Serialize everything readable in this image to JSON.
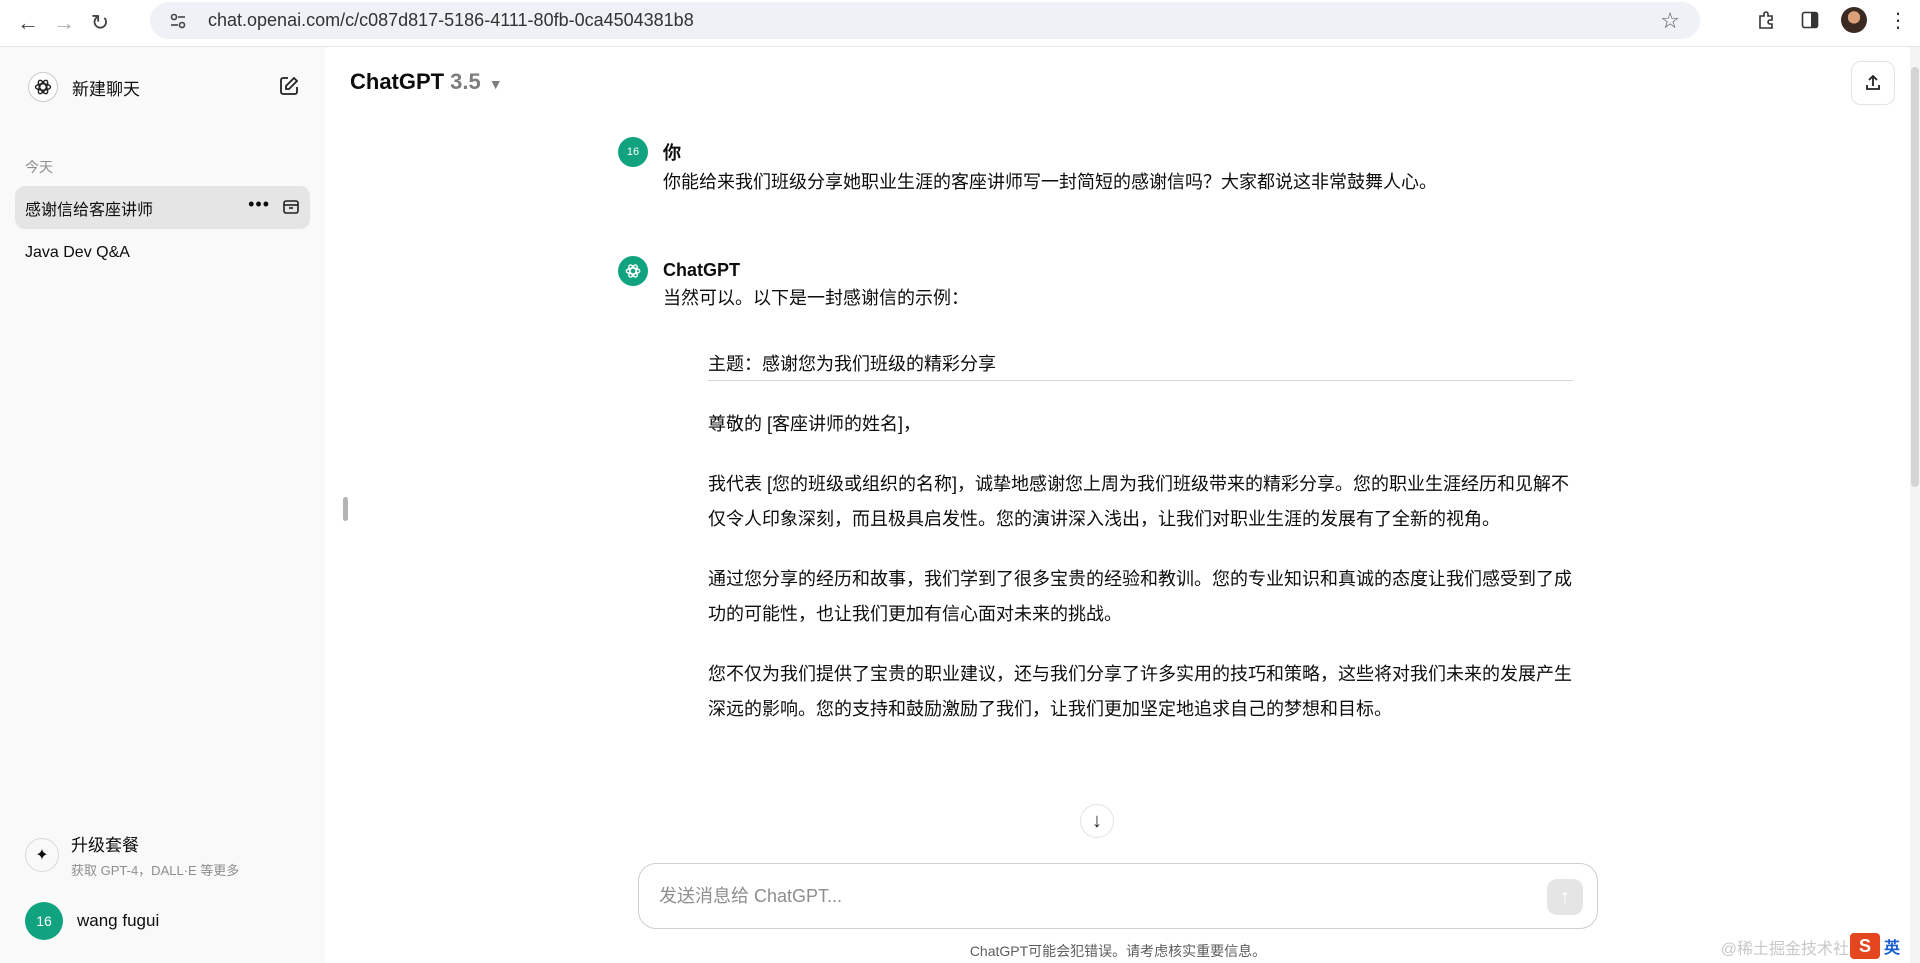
{
  "browser": {
    "url": "chat.openai.com/c/c087d817-5186-4111-80fb-0ca4504381b8"
  },
  "sidebar": {
    "new_chat_label": "新建聊天",
    "section_today": "今天",
    "conversations": [
      {
        "title": "感谢信给客座讲师",
        "active": true
      },
      {
        "title": "Java Dev Q&A",
        "active": false
      }
    ],
    "upgrade_title": "升级套餐",
    "upgrade_subtitle": "获取 GPT-4，DALL·E 等更多",
    "user_avatar_text": "16",
    "user_name": "wang fugui"
  },
  "header": {
    "model_name": "ChatGPT",
    "model_version": "3.5"
  },
  "messages": {
    "user": {
      "avatar_text": "16",
      "author": "你",
      "text": "你能给来我们班级分享她职业生涯的客座讲师写一封简短的感谢信吗？大家都说这非常鼓舞人心。"
    },
    "assistant": {
      "author": "ChatGPT",
      "intro": "当然可以。以下是一封感谢信的示例：",
      "letter": [
        "主题：感谢您为我们班级的精彩分享",
        "尊敬的 [客座讲师的姓名]，",
        "我代表 [您的班级或组织的名称]，诚挚地感谢您上周为我们班级带来的精彩分享。您的职业生涯经历和见解不仅令人印象深刻，而且极具启发性。您的演讲深入浅出，让我们对职业生涯的发展有了全新的视角。",
        "通过您分享的经历和故事，我们学到了很多宝贵的经验和教训。您的专业知识和真诚的态度让我们感受到了成功的可能性，也让我们更加有信心面对未来的挑战。",
        "您不仅为我们提供了宝贵的职业建议，还与我们分享了许多实用的技巧和策略，这些将对我们未来的发展产生深远的影响。您的支持和鼓励激励了我们，让我们更加坚定地追求自己的梦想和目标。"
      ]
    }
  },
  "composer": {
    "placeholder": "发送消息给 ChatGPT..."
  },
  "footer": {
    "disclaimer": "ChatGPT可能会犯错误。请考虑核实重要信息。",
    "watermark": "@稀土掘金技术社区",
    "ime_label": "英"
  }
}
